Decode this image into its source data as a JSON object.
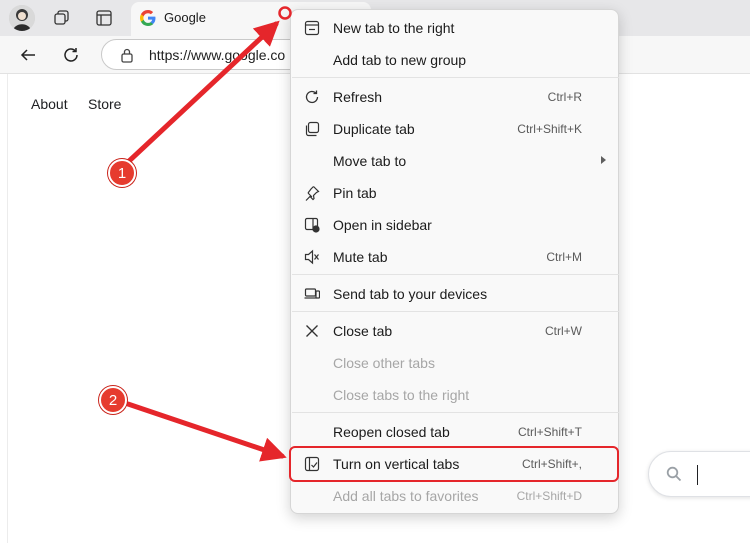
{
  "browser": {
    "tab": {
      "title": "Google",
      "favicon": "G"
    },
    "address": {
      "url": "https://www.google.co"
    }
  },
  "page": {
    "nav": {
      "about": "About",
      "store": "Store"
    }
  },
  "context_menu": {
    "items": [
      {
        "label": "New tab to the right",
        "shortcut": "",
        "icon": "new-tab-icon",
        "disabled": false
      },
      {
        "label": "Add tab to new group",
        "shortcut": "",
        "icon": "",
        "disabled": false
      },
      {
        "label": "Refresh",
        "shortcut": "Ctrl+R",
        "icon": "refresh-icon",
        "disabled": false
      },
      {
        "label": "Duplicate tab",
        "shortcut": "Ctrl+Shift+K",
        "icon": "duplicate-icon",
        "disabled": false
      },
      {
        "label": "Move tab to",
        "shortcut": "",
        "icon": "",
        "disabled": false
      },
      {
        "label": "Pin tab",
        "shortcut": "",
        "icon": "pin-icon",
        "disabled": false
      },
      {
        "label": "Open in sidebar",
        "shortcut": "",
        "icon": "sidebar-icon",
        "disabled": false
      },
      {
        "label": "Mute tab",
        "shortcut": "Ctrl+M",
        "icon": "mute-icon",
        "disabled": false
      },
      {
        "label": "Send tab to your devices",
        "shortcut": "",
        "icon": "devices-icon",
        "disabled": false
      },
      {
        "label": "Close tab",
        "shortcut": "Ctrl+W",
        "icon": "close-icon",
        "disabled": false
      },
      {
        "label": "Close other tabs",
        "shortcut": "",
        "icon": "",
        "disabled": true
      },
      {
        "label": "Close tabs to the right",
        "shortcut": "",
        "icon": "",
        "disabled": true
      },
      {
        "label": "Reopen closed tab",
        "shortcut": "Ctrl+Shift+T",
        "icon": "",
        "disabled": false
      },
      {
        "label": "Turn on vertical tabs",
        "shortcut": "Ctrl+Shift+,",
        "icon": "vertical-tabs-icon",
        "disabled": false
      },
      {
        "label": "Add all tabs to favorites",
        "shortcut": "Ctrl+Shift+D",
        "icon": "",
        "disabled": true
      }
    ]
  },
  "annotations": {
    "badge_1": "1",
    "badge_2": "2",
    "color": "#e5262b"
  }
}
